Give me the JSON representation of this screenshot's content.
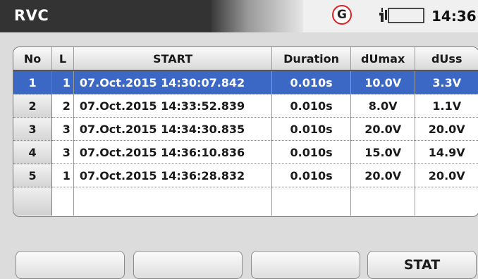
{
  "header": {
    "title": "RVC",
    "status_icon": "G",
    "status_icon_color": "#e02020",
    "battery_icon": "battery-plug-icon",
    "clock": "14:36"
  },
  "table": {
    "columns": [
      "No",
      "L",
      "START",
      "Duration",
      "dUmax",
      "dUss"
    ],
    "rows": [
      {
        "no": "1",
        "l": "1",
        "start": "07.Oct.2015 14:30:07.842",
        "duration": "0.010s",
        "dumax": "10.0V",
        "duss": "3.3V",
        "selected": true
      },
      {
        "no": "2",
        "l": "2",
        "start": "07.Oct.2015 14:33:52.839",
        "duration": "0.010s",
        "dumax": "8.0V",
        "duss": "1.1V"
      },
      {
        "no": "3",
        "l": "3",
        "start": "07.Oct.2015 14:34:30.835",
        "duration": "0.010s",
        "dumax": "20.0V",
        "duss": "20.0V"
      },
      {
        "no": "4",
        "l": "3",
        "start": "07.Oct.2015 14:36:10.836",
        "duration": "0.010s",
        "dumax": "15.0V",
        "duss": "14.9V"
      },
      {
        "no": "5",
        "l": "1",
        "start": "07.Oct.2015 14:36:28.832",
        "duration": "0.010s",
        "dumax": "20.0V",
        "duss": "20.0V"
      }
    ],
    "selected_color": "#3a68c4"
  },
  "softkeys": [
    "",
    "",
    "",
    "STAT"
  ]
}
